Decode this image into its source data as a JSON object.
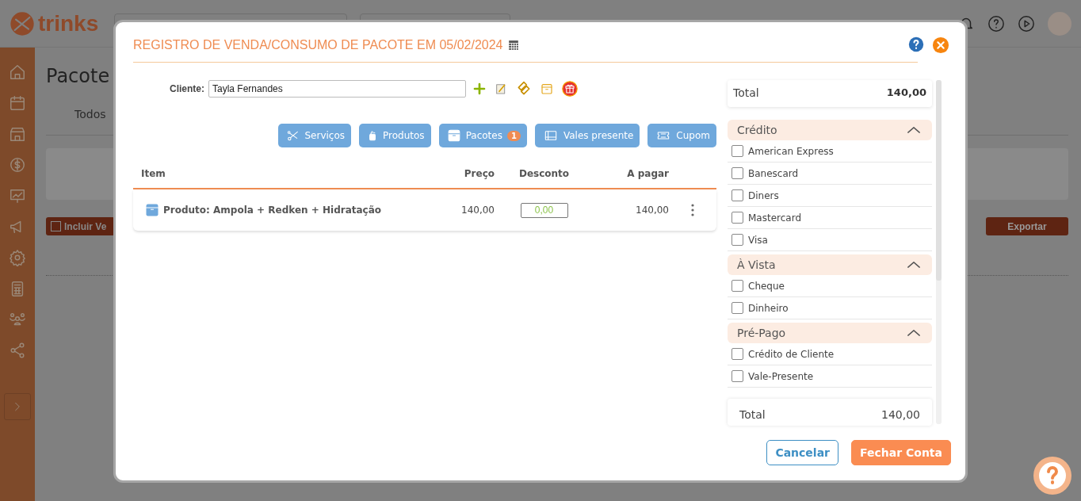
{
  "header": {
    "logo": "trinks"
  },
  "page": {
    "title": "Pacote",
    "tab": "Todos",
    "add_button": "Incluir Ve",
    "export_button": "Exportar"
  },
  "modal": {
    "title": "REGISTRO DE VENDA/CONSUMO DE PACOTE EM 05/02/2024",
    "client_label": "Cliente:",
    "client_value": "Tayla Fernandes",
    "item_buttons": [
      {
        "label": "Serviços",
        "kind": "scissors"
      },
      {
        "label": "Produtos",
        "kind": "bottle"
      },
      {
        "label": "Pacotes",
        "kind": "box",
        "badge": "1"
      },
      {
        "label": "Vales presente",
        "kind": "voucher"
      },
      {
        "label": "Cupom",
        "kind": "ticket"
      }
    ],
    "table": {
      "columns": [
        "Item",
        "Preço",
        "Desconto",
        "A pagar"
      ],
      "rows": [
        {
          "item": "Produto: Ampola + Redken + Hidratação",
          "price": "140,00",
          "discount": "0,00",
          "to_pay": "140,00"
        }
      ]
    },
    "summary": {
      "label": "Total",
      "value": "140,00"
    },
    "payment_groups": [
      {
        "name": "Crédito",
        "expanded": true,
        "methods": [
          {
            "label": "American Express",
            "checked": false
          },
          {
            "label": "Banescard",
            "checked": false
          },
          {
            "label": "Diners",
            "checked": false
          },
          {
            "label": "Mastercard",
            "checked": false
          },
          {
            "label": "Visa",
            "checked": false
          }
        ]
      },
      {
        "name": "À Vista",
        "expanded": true,
        "methods": [
          {
            "label": "Cheque",
            "checked": false
          },
          {
            "label": "Dinheiro",
            "checked": false
          }
        ]
      },
      {
        "name": "Pré-Pago",
        "expanded": true,
        "methods": [
          {
            "label": "Crédito de Cliente",
            "checked": false
          },
          {
            "label": "Vale-Presente",
            "checked": false
          }
        ]
      }
    ],
    "bottom_total": {
      "label": "Total",
      "value": "140,00"
    },
    "buttons": [
      {
        "label": "Cancelar",
        "kind": "secondary"
      },
      {
        "label": "Fechar Conta",
        "kind": "primary"
      }
    ]
  }
}
